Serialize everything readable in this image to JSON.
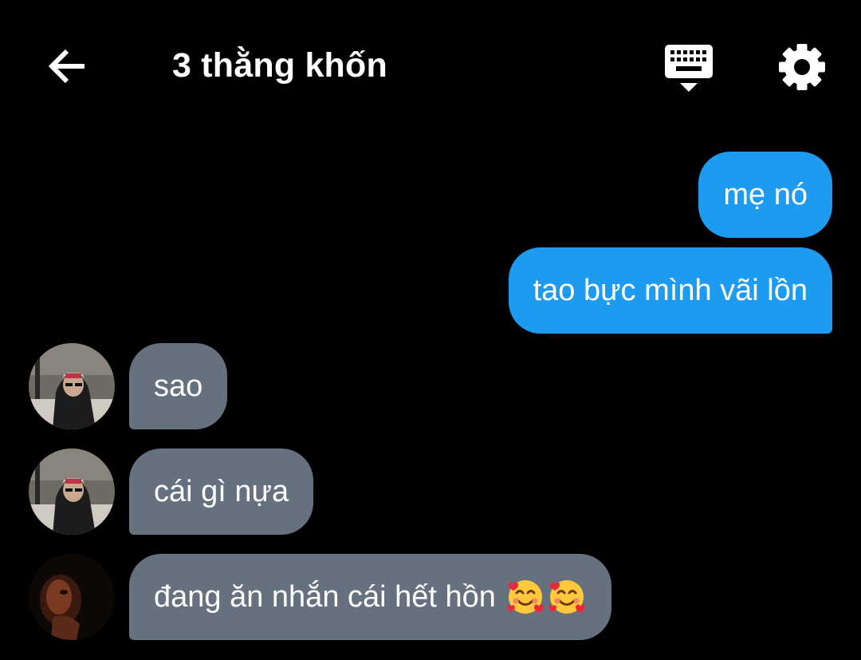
{
  "header": {
    "title": "3 thằng khốn",
    "back_icon": "arrow-left-icon",
    "keyboard_icon": "keyboard-hide-icon",
    "settings_icon": "gear-icon"
  },
  "colors": {
    "background": "#000000",
    "sent_bubble": "#1d9bf0",
    "received_bubble": "#66717f",
    "text": "#ffffff"
  },
  "messages": [
    {
      "direction": "sent",
      "text": "mẹ nó"
    },
    {
      "direction": "sent",
      "text": "tao bực mình vãi lồn"
    },
    {
      "direction": "received",
      "text": "sao",
      "sender_avatar": "hooded-person-avatar"
    },
    {
      "direction": "received",
      "text": "cái gì nựa",
      "sender_avatar": "hooded-person-avatar"
    },
    {
      "direction": "received",
      "text": "đang ăn nhắn cái hết hồn",
      "emojis": [
        "smiling-face-with-hearts",
        "smiling-face-with-hearts"
      ],
      "sender_avatar": "dark-portrait-avatar"
    }
  ]
}
